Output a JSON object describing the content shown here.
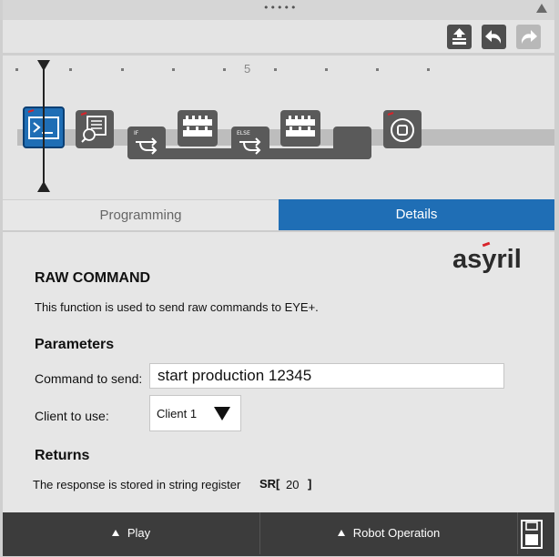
{
  "toolbar": {
    "icons": [
      "upload-icon",
      "undo-icon",
      "redo-icon"
    ]
  },
  "timeline": {
    "marker_label": "5"
  },
  "tabs": [
    {
      "label": "Programming",
      "active": false
    },
    {
      "label": "Details",
      "active": true
    }
  ],
  "details": {
    "logo": "asyril",
    "title": "RAW COMMAND",
    "description": "This function is used to send raw commands to EYE+.",
    "parameters_heading": "Parameters",
    "command_label": "Command to send:",
    "command_value": "start production 12345",
    "client_label": "Client to use:",
    "client_value": "Client 1",
    "returns_heading": "Returns",
    "returns_text": "The response is stored in string register",
    "register_name": "SR[",
    "register_value": "20",
    "register_close": "]"
  },
  "bottom": {
    "play_label": "Play",
    "robot_label": "Robot Operation"
  },
  "colors": {
    "accent": "#1f6eb5",
    "panel": "#e4e4e4",
    "bottom_bar": "#3c3c3c"
  }
}
